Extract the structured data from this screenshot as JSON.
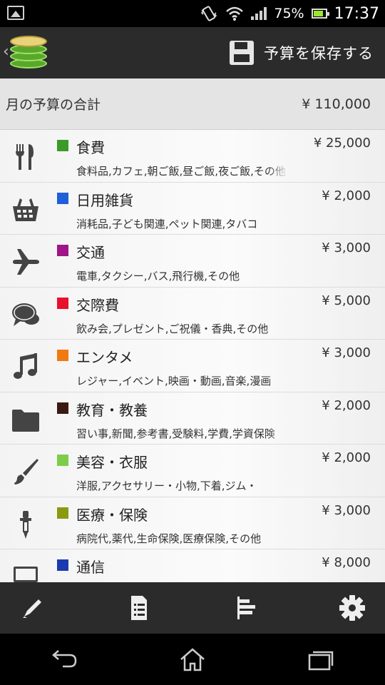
{
  "status_bar": {
    "battery_percent": "75%",
    "time": "17:37"
  },
  "header": {
    "save_label": "予算を保存する"
  },
  "total": {
    "label": "月の予算の合計",
    "value": "¥ 110,000"
  },
  "categories": [
    {
      "icon": "fork-knife-icon",
      "color": "#3a9a2a",
      "name": "食費",
      "amount": "¥ 25,000",
      "desc": "食料品,カフェ,朝ご飯,昼ご飯,夜ご飯,その他"
    },
    {
      "icon": "basket-icon",
      "color": "#1f5fd8",
      "name": "日用雑貨",
      "amount": "¥ 2,000",
      "desc": "消耗品,子ども関連,ペット関連,タバコ"
    },
    {
      "icon": "airplane-icon",
      "color": "#a0158a",
      "name": "交通",
      "amount": "¥ 3,000",
      "desc": "電車,タクシー,バス,飛行機,その他"
    },
    {
      "icon": "speech-bubble-icon",
      "color": "#e8102a",
      "name": "交際費",
      "amount": "¥ 5,000",
      "desc": "飲み会,プレゼント,ご祝儀・香典,その他"
    },
    {
      "icon": "music-note-icon",
      "color": "#f07a10",
      "name": "エンタメ",
      "amount": "¥ 3,000",
      "desc": "レジャー,イベント,映画・動画,音楽,漫画"
    },
    {
      "icon": "folder-icon",
      "color": "#3a1a10",
      "name": "教育・教養",
      "amount": "¥ 2,000",
      "desc": "習い事,新聞,参考書,受験料,学費,学資保険"
    },
    {
      "icon": "paintbrush-icon",
      "color": "#7ccd4a",
      "name": "美容・衣服",
      "amount": "¥ 2,000",
      "desc": "洋服,アクセサリー・小物,下着,ジム・"
    },
    {
      "icon": "dropper-icon",
      "color": "#8a9a10",
      "name": "医療・保険",
      "amount": "¥ 3,000",
      "desc": "病院代,薬代,生命保険,医療保険,その他"
    },
    {
      "icon": "computer-icon",
      "color": "#1a3ab0",
      "name": "通信",
      "amount": "¥ 8,000",
      "desc": ""
    }
  ]
}
